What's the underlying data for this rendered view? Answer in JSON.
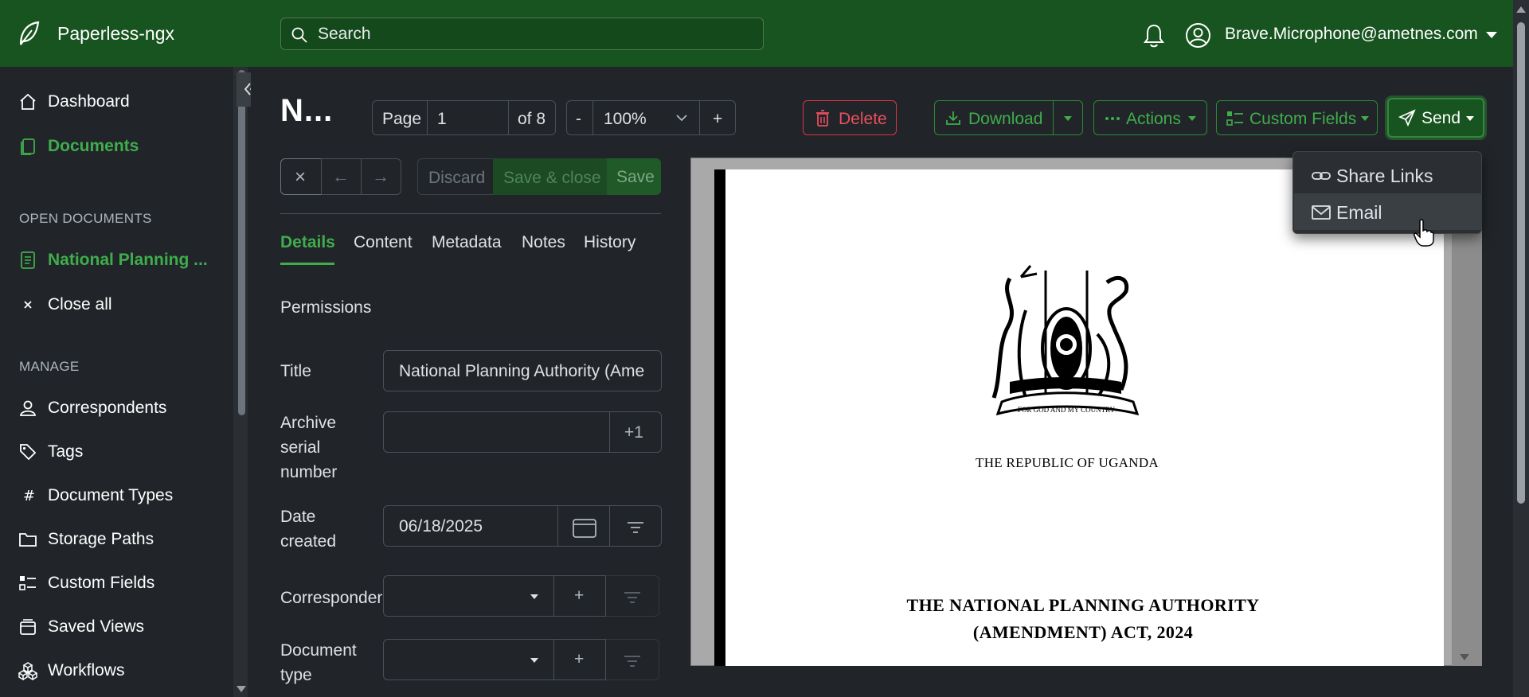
{
  "app": {
    "name": "Paperless-ngx",
    "search_placeholder": "Search",
    "user_email": "Brave.Microphone@ametnes.com",
    "colors": {
      "topbar": "#17541f",
      "accent": "#3fad4b",
      "danger": "#dc3545",
      "background": "#212529"
    }
  },
  "sidebar": {
    "dashboard": "Dashboard",
    "documents": "Documents",
    "open_documents_heading": "OPEN DOCUMENTS",
    "open_document": "National Planning ...",
    "close_all": "Close all",
    "manage_heading": "MANAGE",
    "manage_items": [
      "Correspondents",
      "Tags",
      "Document Types",
      "Storage Paths",
      "Custom Fields",
      "Saved Views",
      "Workflows"
    ]
  },
  "toolbar": {
    "doc_title_short": "N...",
    "page_label": "Page",
    "page_value": "1",
    "page_of": "of 8",
    "zoom_minus": "-",
    "zoom_value": "100%",
    "zoom_plus": "+",
    "delete": "Delete",
    "download": "Download",
    "actions": "Actions",
    "custom_fields": "Custom Fields",
    "send": "Send"
  },
  "send_menu": {
    "share_links": "Share Links",
    "email": "Email"
  },
  "edit_bar": {
    "close": "×",
    "prev": "←",
    "next": "→",
    "discard": "Discard",
    "save_close": "Save & close",
    "save": "Save"
  },
  "tabs": [
    "Details",
    "Content",
    "Metadata",
    "Notes",
    "History"
  ],
  "details": {
    "permissions": "Permissions",
    "title_label": "Title",
    "title_value": "National Planning Authority (Ame",
    "asn_label": "Archive serial number",
    "asn_addon": "+1",
    "date_label": "Date created",
    "date_value": "06/18/2025",
    "correspondent_label": "Correspondent",
    "doctype_label": "Document type",
    "add": "+"
  },
  "preview": {
    "republic": "THE REPUBLIC OF UGANDA",
    "act_line1": "THE NATIONAL PLANNING AUTHORITY",
    "act_line2": "(AMENDMENT) ACT, 2024",
    "crest_motto": "FOR GOD AND MY COUNTRY"
  }
}
